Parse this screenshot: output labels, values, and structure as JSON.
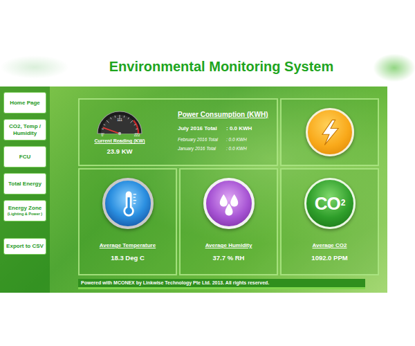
{
  "header": {
    "title": "Environmental Monitoring System"
  },
  "sidebar": {
    "items": [
      {
        "label": "Home Page"
      },
      {
        "label": "CO2, Temp / Humidity"
      },
      {
        "label": "FCU"
      },
      {
        "label": "Total Energy"
      },
      {
        "label": "Energy Zone",
        "sub": "(Lighting & Power )"
      }
    ],
    "export_button": {
      "label": "Export to CSV"
    }
  },
  "gauge": {
    "label": "Current Reading (KW)",
    "reading": "23.9 KW",
    "ticks": [
      "0",
      "111",
      "222"
    ],
    "level": 0.108
  },
  "power": {
    "title": "Power Consumption (KWH)",
    "rows": [
      {
        "label": "July 2016 Total",
        "value": ": 0.0 KWH",
        "kind": "current"
      },
      {
        "label": "February 2016 Total",
        "value": ": 0.0 KWH",
        "kind": "past"
      },
      {
        "label": "January 2016 Total",
        "value": ": 0.0 KWH",
        "kind": "past"
      }
    ]
  },
  "metrics": [
    {
      "label": "Average Temperature",
      "value": "18.3 Deg C",
      "kind": "temperature"
    },
    {
      "label": "Average Humidity",
      "value": "37.7 % RH",
      "kind": "humidity"
    },
    {
      "label": "Average CO2",
      "value": "1092.0 PPM",
      "kind": "co2",
      "icon_text": "CO",
      "icon_sub": "2"
    }
  ],
  "footer": {
    "text": "Powered with MCONEX by Linkwise Technology Pte Ltd. 2013. All rights reserved."
  }
}
